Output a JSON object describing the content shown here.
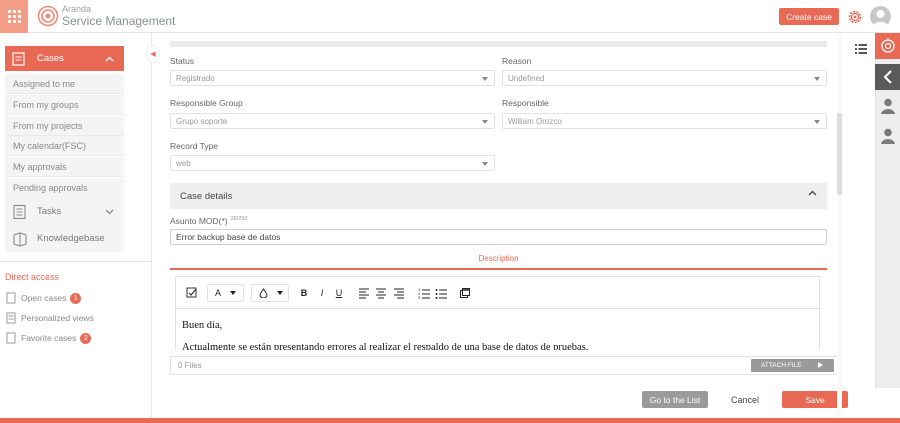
{
  "header": {
    "brand_small": "Aranda",
    "brand_big": "Service Management",
    "create_case_label": "Create case"
  },
  "sidebar": {
    "cases_label": "Cases",
    "items": [
      {
        "label": "Assigned to me"
      },
      {
        "label": "From my groups"
      },
      {
        "label": "From my projects"
      },
      {
        "label": "My calendar(FSC)"
      },
      {
        "label": "My approvals"
      },
      {
        "label": "Pending approvals"
      }
    ],
    "tasks_label": "Tasks",
    "knowledgebase_label": "Knowledgebase",
    "direct_access_title": "Direct access",
    "direct_items": [
      {
        "label": "Open cases",
        "badge": "1"
      },
      {
        "label": "Personalized views"
      },
      {
        "label": "Favorite cases",
        "badge": "2"
      }
    ]
  },
  "form": {
    "status_label": "Status",
    "status_value": "Registrado",
    "reason_label": "Reason",
    "reason_value": "Undefined",
    "group_label": "Responsible Group",
    "group_value": "Grupo soporte",
    "responsible_label": "Responsible",
    "responsible_value": "William Orozco",
    "record_type_label": "Record Type",
    "record_type_value": "web",
    "section_title": "Case details",
    "subject_label": "Asunto MOD(*)",
    "subject_counter": "28/250",
    "subject_value": "Error backup base de datos",
    "description_tab": "Description",
    "editor_line1": "Buen día,",
    "editor_line2": "Actualmente se están presentando errores al realizar el respaldo de una base de datos de pruebas.",
    "files_label": "0 Files",
    "attach_label": "ATTACH FILE"
  },
  "toolbar": {
    "font_color_glyph": "A",
    "bold": "B",
    "italic": "I",
    "underline": "U"
  },
  "actions": {
    "go_to_list": "Go to the List",
    "cancel": "Cancel",
    "save": "Save"
  },
  "colors": {
    "accent": "#e86a55",
    "gray_button": "#9a9a9a"
  }
}
